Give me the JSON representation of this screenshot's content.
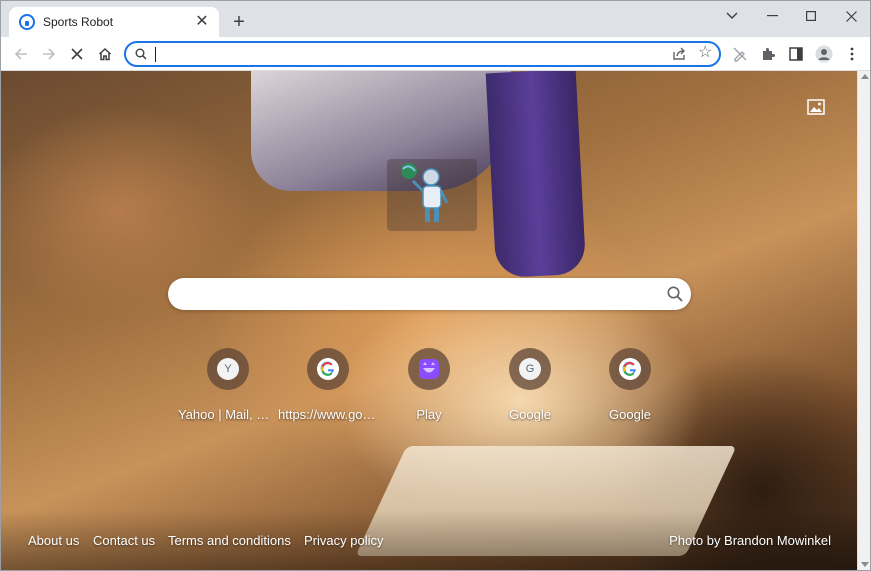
{
  "tab": {
    "title": "Sports Robot",
    "close": "✕"
  },
  "new_tab": "+",
  "window_controls": {
    "menu": "⌄",
    "minimize": "—",
    "maximize": "☐",
    "close": "✕"
  },
  "omnibox": {
    "value": "",
    "placeholder": ""
  },
  "search": {
    "value": "",
    "placeholder": ""
  },
  "shortcuts": [
    {
      "label": "Yahoo | Mail, Weather, Search, Politics, News, Finance, Sports & Videos",
      "glyph": "Y",
      "icon": "y-letter-icon"
    },
    {
      "label": "https://www.google.com/",
      "glyph": "",
      "icon": "google-icon"
    },
    {
      "label": "Play",
      "glyph": "",
      "icon": "play-app-icon"
    },
    {
      "label": "Google",
      "glyph": "G",
      "icon": "g-letter-icon"
    },
    {
      "label": "Google",
      "glyph": "",
      "icon": "google-icon"
    }
  ],
  "footer": {
    "about": "About us",
    "contact": "Contact us",
    "terms": "Terms and conditions",
    "privacy": "Privacy policy",
    "credit": "Photo by Brandon Mowinkel"
  },
  "colors": {
    "accent": "#1a73e8",
    "tab_bg": "#ffffff",
    "chrome_bg": "#dee1e6"
  }
}
